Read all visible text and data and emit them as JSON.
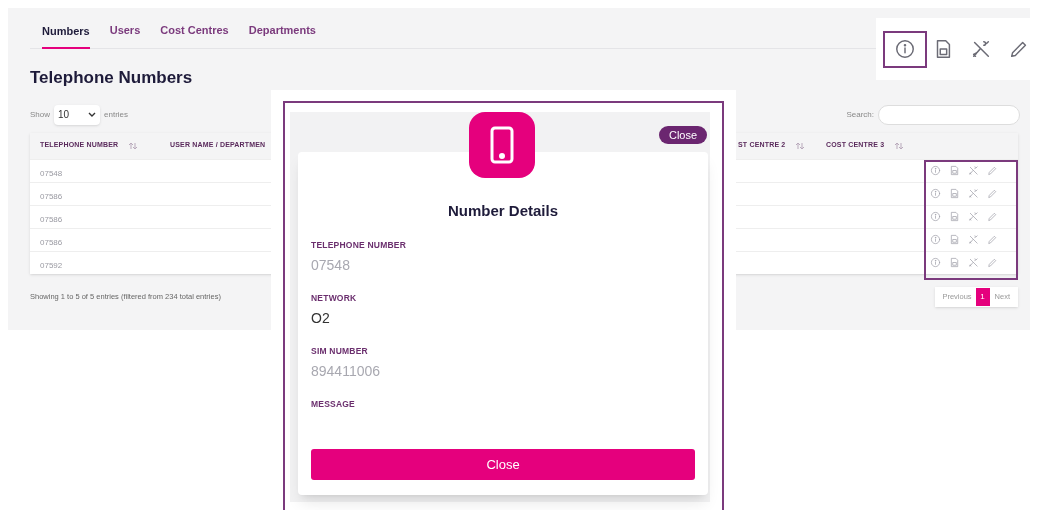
{
  "tabs": [
    {
      "label": "Numbers",
      "selected": true
    },
    {
      "label": "Users",
      "selected": false
    },
    {
      "label": "Cost Centres",
      "selected": false
    },
    {
      "label": "Departments",
      "selected": false
    }
  ],
  "title": "Telephone Numbers",
  "length_menu": {
    "show": "Show",
    "value": "10",
    "entries": "entries"
  },
  "search": {
    "label": "Search:"
  },
  "table": {
    "columns": [
      {
        "label": "TELEPHONE NUMBER",
        "sortable": true
      },
      {
        "label": "USER NAME / DEPARTMEN"
      },
      {
        "label": "ST CENTRE 2",
        "sortable": true
      },
      {
        "label": "COST CENTRE 3",
        "sortable": true
      }
    ],
    "rows": [
      {
        "telephone_number": "07548"
      },
      {
        "telephone_number": "07586"
      },
      {
        "telephone_number": "07586"
      },
      {
        "telephone_number": "07586"
      },
      {
        "telephone_number": "07592"
      }
    ]
  },
  "info": "Showing 1 to 5 of 5 entries (filtered from 234 total entries)",
  "pagination": {
    "previous": "Previous",
    "pages": [
      {
        "label": "1",
        "selected": true
      }
    ],
    "next": "Next"
  },
  "callout_icons": [
    {
      "kind": "info",
      "selected": true
    },
    {
      "kind": "sim",
      "selected": false
    },
    {
      "kind": "phone-off",
      "selected": false
    },
    {
      "kind": "pencil",
      "selected": false
    }
  ],
  "modal": {
    "close_pill": "Close",
    "title": "Number Details",
    "fields": [
      {
        "label": "TELEPHONE NUMBER",
        "value": "07548",
        "faded": true
      },
      {
        "label": "NETWORK",
        "value": "O2",
        "faded": false
      },
      {
        "label": "SIM NUMBER",
        "value": "894411006",
        "faded": true
      },
      {
        "label": "MESSAGE"
      }
    ],
    "close_button": "Close"
  }
}
